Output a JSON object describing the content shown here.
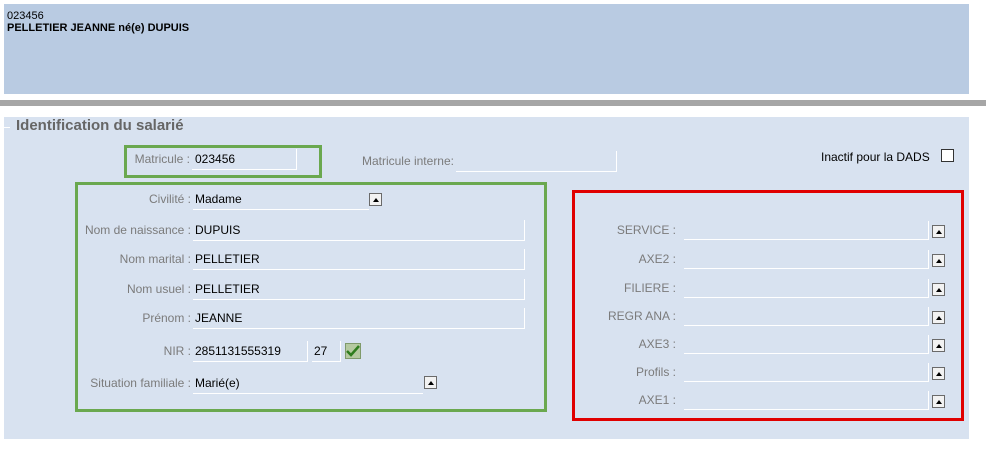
{
  "header": {
    "employee_id": "023456",
    "employee_name": "PELLETIER JEANNE né(e) DUPUIS"
  },
  "panel": {
    "title": "Identification du salarié",
    "matricule_label": "Matricule :",
    "matricule_value": "023456",
    "matricule_interne_label": "Matricule interne:",
    "matricule_interne_value": "",
    "inactif_label": "Inactif pour la DADS",
    "inactif_checked": false
  },
  "identity": {
    "civilite_label": "Civilité :",
    "civilite_value": "Madame",
    "nom_naissance_label": "Nom de naissance :",
    "nom_naissance_value": "DUPUIS",
    "nom_marital_label": "Nom marital :",
    "nom_marital_value": "PELLETIER",
    "nom_usuel_label": "Nom usuel :",
    "nom_usuel_value": "PELLETIER",
    "prenom_label": "Prénom :",
    "prenom_value": "JEANNE",
    "nir_label": "NIR :",
    "nir_value": "2851131555319",
    "nir_key": "27",
    "situation_label": "Situation familiale :",
    "situation_value": "Marié(e)"
  },
  "analytics": {
    "fields": [
      {
        "label": "SERVICE :",
        "value": ""
      },
      {
        "label": "AXE2 :",
        "value": ""
      },
      {
        "label": "FILIERE :",
        "value": ""
      },
      {
        "label": "REGR ANA :",
        "value": ""
      },
      {
        "label": "AXE3 :",
        "value": ""
      },
      {
        "label": "Profils :",
        "value": ""
      },
      {
        "label": "AXE1 :",
        "value": ""
      }
    ]
  },
  "colors": {
    "header_bg": "#b9cbe2",
    "panel_bg": "#d8e2f0",
    "highlight_green": "#6aa84f",
    "highlight_red": "#e00000"
  }
}
